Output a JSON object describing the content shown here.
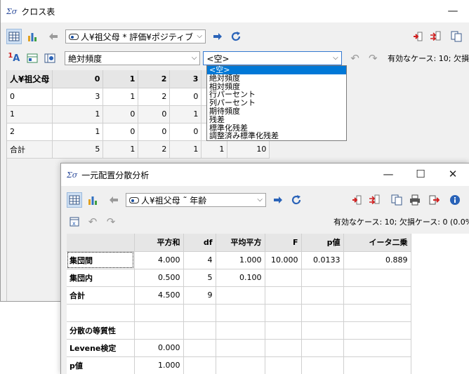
{
  "cross": {
    "logo": "Σσ",
    "title": "クロス表",
    "variable_combo": "人¥祖父母 * 評価¥ポジティブ",
    "mode_combo": "絶対頻度",
    "second_combo": "<空>",
    "valid_cases": "有効なケース: 10;  欠損",
    "dropdown_options": [
      "<空>",
      "絶対頻度",
      "相対頻度",
      "行パーセント",
      "列パーセント",
      "期待頻度",
      "残差",
      "標準化残差",
      "調整済み標準化残差"
    ],
    "table": {
      "corner": "人¥祖父母",
      "columns": [
        "0",
        "1",
        "2",
        "3"
      ],
      "rows": [
        {
          "label": "0",
          "values": [
            "3",
            "1",
            "2",
            "0"
          ]
        },
        {
          "label": "1",
          "values": [
            "1",
            "0",
            "0",
            "1"
          ]
        },
        {
          "label": "2",
          "values": [
            "1",
            "0",
            "0",
            "0"
          ]
        },
        {
          "label": "合計",
          "values": [
            "5",
            "1",
            "2",
            "1",
            "1",
            "10"
          ]
        }
      ]
    }
  },
  "anova": {
    "logo": "Σσ",
    "title": "一元配置分散分析",
    "variable_combo": "人¥祖父母 ˜ 年齢",
    "valid_cases": "有効なケース: 10;  欠損ケース: 0 (0.0%)",
    "table": {
      "columns": [
        "",
        "平方和",
        "df",
        "平均平方",
        "F",
        "p値",
        "イータ二乗"
      ],
      "rows": [
        [
          "集団間",
          "4.000",
          "4",
          "1.000",
          "10.000",
          "0.0133",
          "0.889"
        ],
        [
          "集団内",
          "0.500",
          "5",
          "0.100",
          "",
          "",
          ""
        ],
        [
          "合計",
          "4.500",
          "9",
          "",
          "",
          "",
          ""
        ],
        [
          "",
          "",
          "",
          "",
          "",
          "",
          ""
        ],
        [
          "分散の等質性",
          "",
          "",
          "",
          "",
          "",
          ""
        ],
        [
          "Levene検定",
          "0.000",
          "",
          "",
          "",
          "",
          ""
        ],
        [
          "p値",
          "1.000",
          "",
          "",
          "",
          "",
          ""
        ]
      ]
    }
  }
}
